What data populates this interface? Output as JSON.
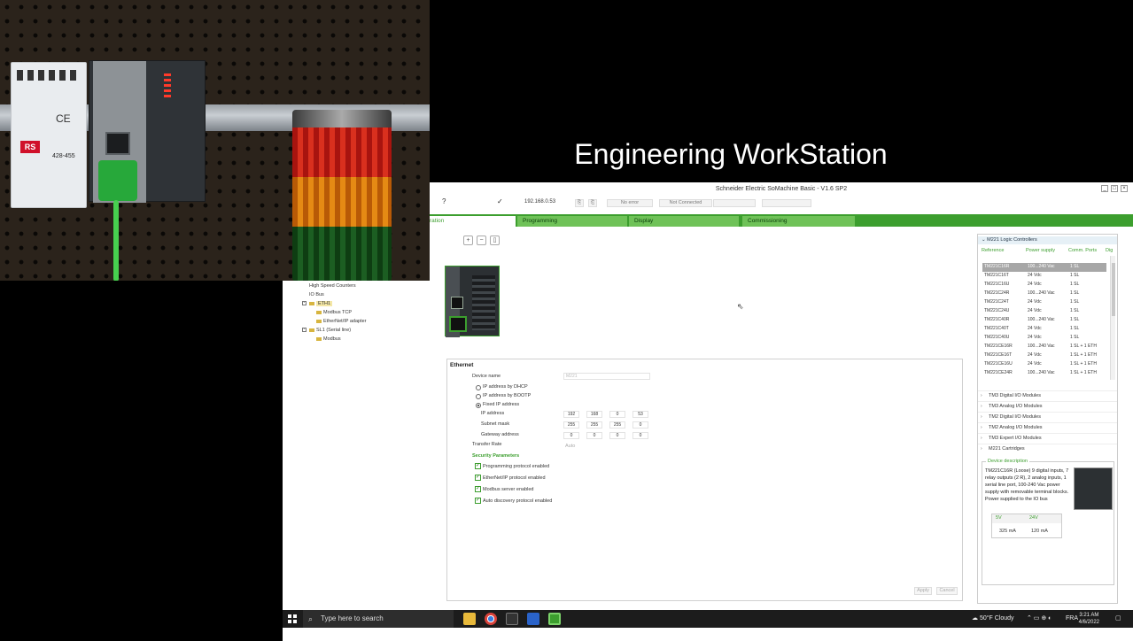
{
  "banner": {
    "title": "Engineering WorkStation"
  },
  "camera": {
    "psu_brand": "RS",
    "psu_part": "428-455",
    "psu_ce": "CE"
  },
  "app": {
    "window_title": "Schneider Electric SoMachine Basic - V1.6 SP2",
    "toolbar": {
      "ip": "192.168.0.53",
      "status1": "No error",
      "status2": "Not Connected"
    },
    "tabs": [
      {
        "label": "ration"
      },
      {
        "label": "Programming"
      },
      {
        "label": "Display"
      },
      {
        "label": "Commissioning"
      }
    ],
    "tree": [
      {
        "label": "High Speed Counters"
      },
      {
        "label": "IO Bus"
      },
      {
        "label": "ETH1"
      },
      {
        "label": "Modbus TCP"
      },
      {
        "label": "EtherNet/IP adapter"
      },
      {
        "label": "SL1 (Serial line)"
      },
      {
        "label": "Modbus"
      }
    ],
    "ethernet": {
      "heading": "Ethernet",
      "device_name_label": "Device name",
      "device_name_value": "M221",
      "opt_dhcp": "IP address by DHCP",
      "opt_bootp": "IP address by BOOTP",
      "opt_fixed": "Fixed IP address",
      "ip_label": "IP address",
      "ip": [
        "192",
        "168",
        "0",
        "53"
      ],
      "mask_label": "Subnet mask",
      "mask": [
        "255",
        "255",
        "255",
        "0"
      ],
      "gw_label": "Gateway address",
      "gw": [
        "0",
        "0",
        "0",
        "0"
      ],
      "rate_label": "Transfer Rate",
      "rate_value": "Auto",
      "security_heading": "Security Parameters",
      "checks": [
        "Programming protocol enabled",
        "EtherNet/IP protocol enabled",
        "Modbus server enabled",
        "Auto discovery protocol enabled"
      ],
      "apply": "Apply",
      "cancel": "Cancel"
    },
    "catalog": {
      "header": "M221 Logic Controllers",
      "columns": [
        "Reference",
        "Power supply",
        "Comm. Ports",
        "Dig"
      ],
      "rows": [
        [
          "TM221C16R",
          "100...240 Vac",
          "1 SL"
        ],
        [
          "TM221C16T",
          "24 Vdc",
          "1 SL"
        ],
        [
          "TM221C16U",
          "24 Vdc",
          "1 SL"
        ],
        [
          "TM221C24R",
          "100...240 Vac",
          "1 SL"
        ],
        [
          "TM221C24T",
          "24 Vdc",
          "1 SL"
        ],
        [
          "TM221C24U",
          "24 Vdc",
          "1 SL"
        ],
        [
          "TM221C40R",
          "100...240 Vac",
          "1 SL"
        ],
        [
          "TM221C40T",
          "24 Vdc",
          "1 SL"
        ],
        [
          "TM221C40U",
          "24 Vdc",
          "1 SL"
        ],
        [
          "TM221CE16R",
          "100...240 Vac",
          "1 SL + 1 ETH"
        ],
        [
          "TM221CE16T",
          "24 Vdc",
          "1 SL + 1 ETH"
        ],
        [
          "TM221CE16U",
          "24 Vdc",
          "1 SL + 1 ETH"
        ],
        [
          "TM221CE24R",
          "100...240 Vac",
          "1 SL + 1 ETH"
        ]
      ],
      "groups": [
        "TM3 Digital I/O Modules",
        "TM3 Analog I/O Modules",
        "TM2 Digital I/O Modules",
        "TM2 Analog I/O Modules",
        "TM3 Expert I/O Modules",
        "M221 Cartridges"
      ],
      "desc_title": "Device description",
      "desc_text": "TM221C16R (Loose) 9 digital inputs, 7 relay outputs (2 R), 2 analog inputs, 1 serial line port, 100-240 Vac power supply with removable terminal blocks.",
      "desc_power": "Power supplied to the IO bus",
      "power_cols": [
        "5V",
        "24V"
      ],
      "power_vals": [
        "325 mA",
        "120 mA"
      ]
    }
  },
  "taskbar": {
    "search_placeholder": "Type here to search",
    "weather": "50°F  Cloudy",
    "lang": "FRA",
    "time": "3:21 AM",
    "date": "4/6/2022"
  }
}
